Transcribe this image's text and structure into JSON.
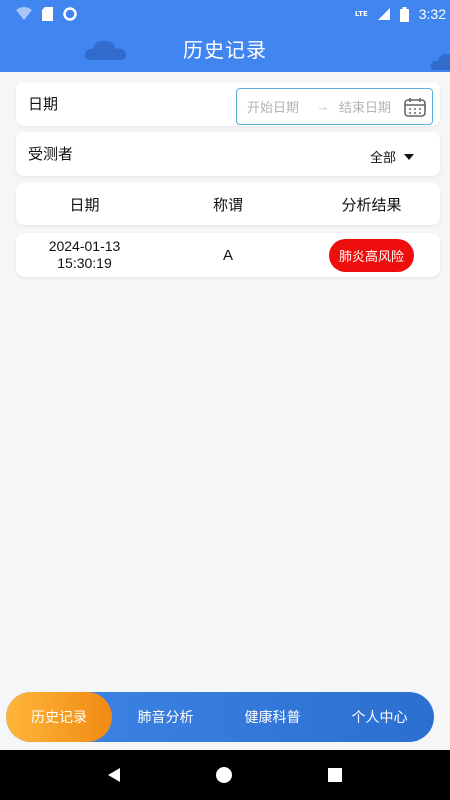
{
  "status_bar": {
    "time": "3:32",
    "network_label": "LTE",
    "icons": [
      "wifi-icon",
      "sim-card-icon",
      "circle-app-icon",
      "signal-icon",
      "battery-icon"
    ]
  },
  "header": {
    "title": "历史记录",
    "background_color": "#4186f0"
  },
  "filters": {
    "date_label": "日期",
    "start_placeholder": "开始日期",
    "range_separator": "→",
    "end_placeholder": "结束日期",
    "subject_label": "受测者",
    "subject_value": "全部"
  },
  "table": {
    "headers": [
      "日期",
      "称谓",
      "分析结果"
    ],
    "rows": [
      {
        "date": "2024-01-13",
        "time": "15:30:19",
        "name": "A",
        "result": "肺炎高风险",
        "result_color": "#ee0e0e"
      }
    ]
  },
  "bottom_nav": {
    "items": [
      "历史记录",
      "肺音分析",
      "健康科普",
      "个人中心"
    ],
    "active_index": 0,
    "active_color": "#f5a025",
    "bar_color": "#3a80e2"
  }
}
